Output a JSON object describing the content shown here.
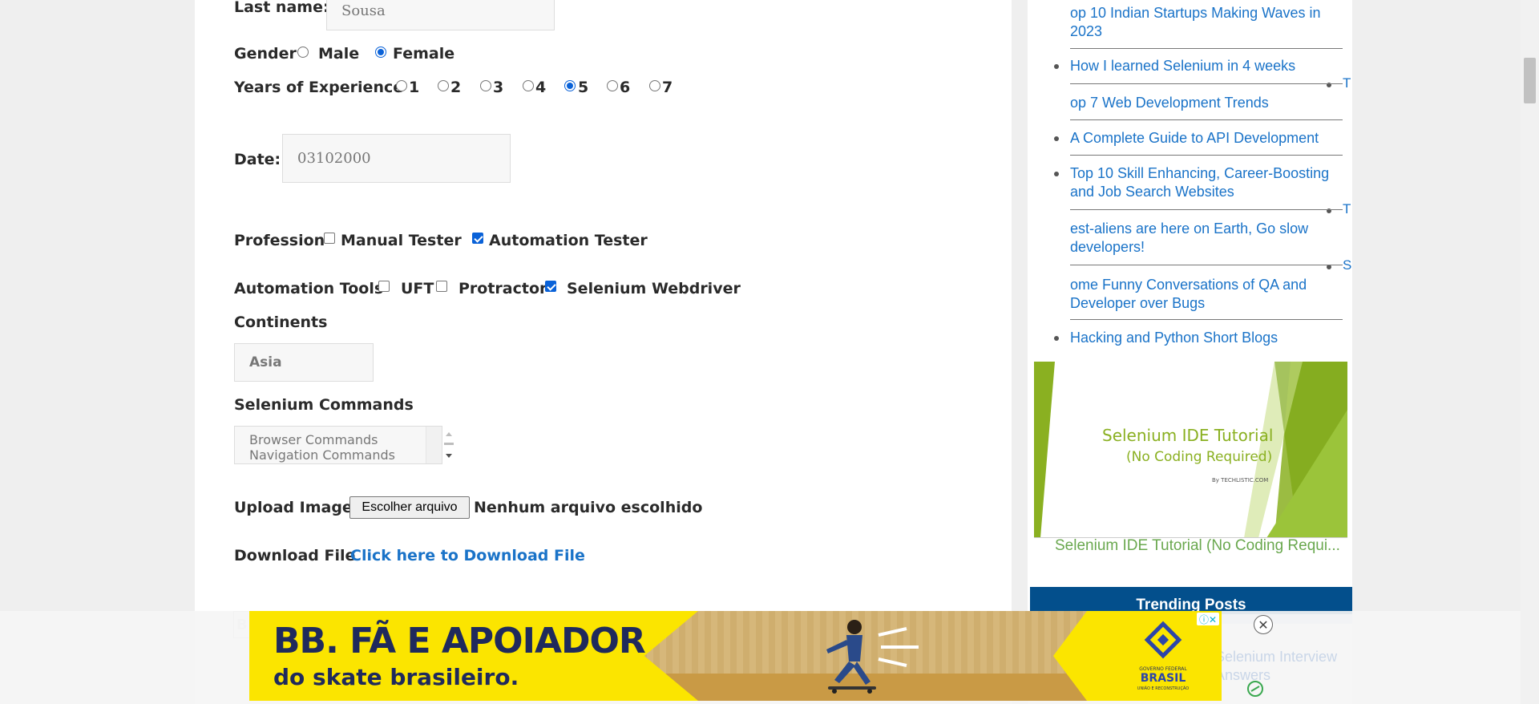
{
  "form": {
    "last_name_label": "Last name:",
    "last_name_value": "Sousa",
    "gender_label": "Gender",
    "gender_options": [
      "Male",
      "Female"
    ],
    "gender_selected": "Female",
    "experience_label": "Years of Experience",
    "experience_options": [
      "1",
      "2",
      "3",
      "4",
      "5",
      "6",
      "7"
    ],
    "experience_selected": "5",
    "date_label": "Date:",
    "date_value": "03102000",
    "profession_label": "Profession",
    "profession_options": [
      "Manual Tester",
      "Automation Tester"
    ],
    "profession_checked": [
      "Automation Tester"
    ],
    "tools_label": "Automation Tools",
    "tools_options": [
      "UFT",
      "Protractor",
      "Selenium Webdriver"
    ],
    "tools_checked": [
      "Selenium Webdriver"
    ],
    "continents_label": "Continents",
    "continents_value": "Asia",
    "commands_label": "Selenium Commands",
    "commands_options": [
      "Browser Commands",
      "Navigation Commands"
    ],
    "upload_label": "Upload Image",
    "upload_button": "Escolher arquivo",
    "upload_status": "Nenhum arquivo escolhido",
    "download_label": "Download File",
    "download_link": "Click here to Download File",
    "button_partial": "B"
  },
  "sidebar": {
    "items": [
      "op 10 Indian Startups Making Waves in",
      "2023",
      "How I learned Selenium in 4 weeks",
      "op 7 Web Development Trends",
      "A Complete Guide to API Development",
      "Top 10 Skill Enhancing, Career-Boosting",
      "and Job Search Websites",
      "est-aliens are here on Earth, Go slow",
      "developers!",
      "ome Funny Conversations of QA and",
      "Developer over Bugs",
      "Hacking and Python Short Blogs"
    ],
    "stray_letters": [
      "T",
      "T",
      "S"
    ],
    "thumbnail_title": "Selenium IDE Tutorial",
    "thumbnail_subtitle": "(No Coding Required)",
    "thumbnail_by": "By TECHLISTIC.COM",
    "thumbnail_caption": "Selenium IDE Tutorial (No Coding Requi...",
    "trending_title": "Trending Posts",
    "faded_lines": [
      "Selenium Interview",
      "Answers"
    ]
  },
  "ad": {
    "line1": "BB. FÃ E APOIADOR",
    "line2": "do skate brasileiro.",
    "gov_text": "GOVERNO FEDERAL",
    "gov_brand": "BRASIL",
    "gov_sub": "UNIÃO E RECONSTRUÇÃO",
    "info_icon": "ⓘ✕",
    "close_icon": "✕"
  },
  "colors": {
    "link": "#1a73c8",
    "accent_check": "#0a62d8",
    "trending_bg": "#034f8c",
    "caption_green": "#6aa84f",
    "ad_yellow": "#fbe500",
    "ad_navy": "#1f2a5c"
  }
}
